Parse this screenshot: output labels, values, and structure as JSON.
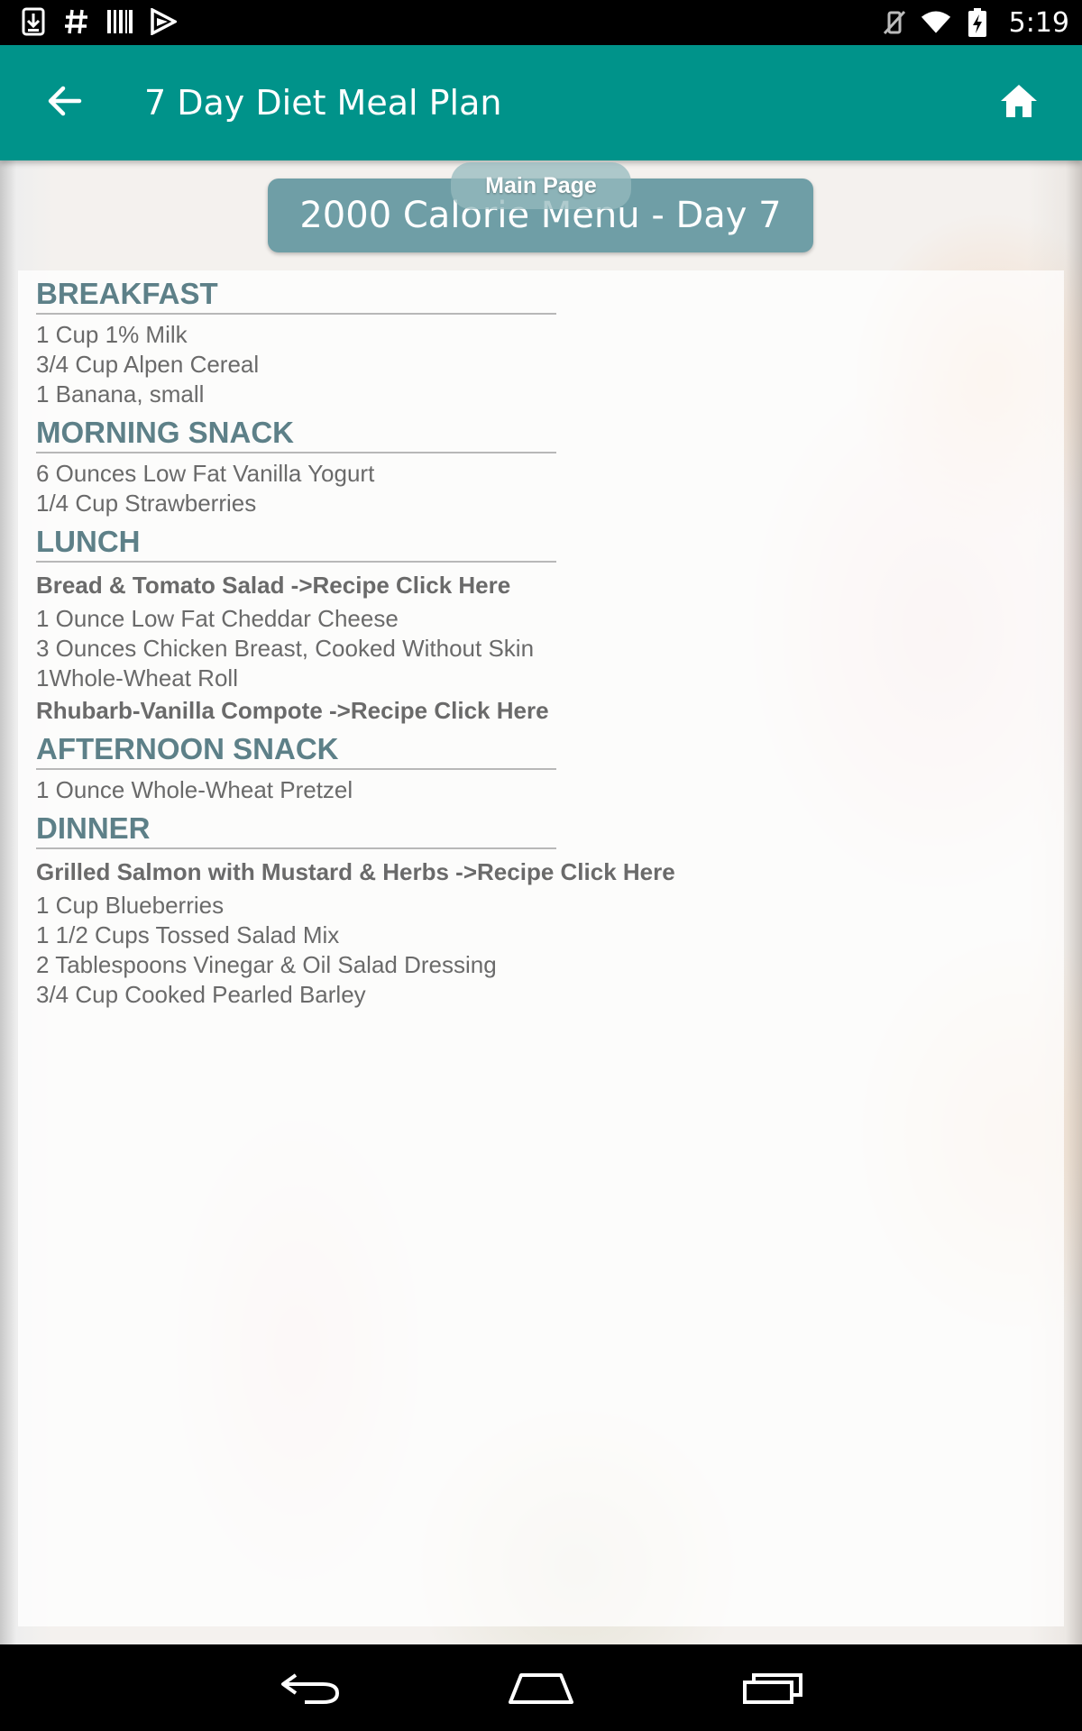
{
  "status_bar": {
    "time": "5:19",
    "left_icons": [
      "download-icon",
      "hash-icon",
      "barcode-icon",
      "play-store-icon"
    ],
    "right_icons": [
      "vibrate-off-icon",
      "wifi-icon",
      "battery-icon"
    ]
  },
  "app_bar": {
    "title": "7 Day Diet Meal Plan",
    "back_icon": "arrow-left-icon",
    "home_icon": "home-icon"
  },
  "header": {
    "main_page_label": "Main Page",
    "menu_title": "2000 Calorie Menu - Day 7"
  },
  "menu": {
    "breakfast": {
      "heading": "BREAKFAST",
      "items": [
        "1 Cup 1% Milk",
        "3/4 Cup Alpen Cereal",
        "1 Banana, small"
      ]
    },
    "morning_snack": {
      "heading": "MORNING SNACK",
      "items": [
        "6 Ounces Low Fat Vanilla Yogurt",
        "1/4 Cup Strawberries"
      ]
    },
    "lunch": {
      "heading": "LUNCH",
      "recipe1": "Bread & Tomato Salad ->Recipe Click Here",
      "items": [
        "1 Ounce Low Fat Cheddar Cheese",
        "3 Ounces Chicken Breast, Cooked Without Skin",
        "1Whole-Wheat Roll"
      ],
      "recipe2": "Rhubarb-Vanilla Compote ->Recipe Click Here"
    },
    "afternoon_snack": {
      "heading": "AFTERNOON SNACK",
      "items": [
        "1 Ounce Whole-Wheat Pretzel"
      ]
    },
    "dinner": {
      "heading": "DINNER",
      "recipe1": "Grilled Salmon with Mustard & Herbs ->Recipe Click Here",
      "items": [
        "1 Cup Blueberries",
        "1 1/2 Cups Tossed Salad Mix",
        "2 Tablespoons Vinegar & Oil Salad Dressing",
        "3/4 Cup Cooked Pearled Barley"
      ]
    }
  },
  "nav_bar": {
    "icons": [
      "back-nav-icon",
      "home-nav-icon",
      "recents-nav-icon"
    ]
  },
  "colors": {
    "app_bar": "#00938a",
    "title_pill": "#6f9ea6",
    "section_heading": "#5d8088",
    "body_text": "#6a6a6a"
  }
}
